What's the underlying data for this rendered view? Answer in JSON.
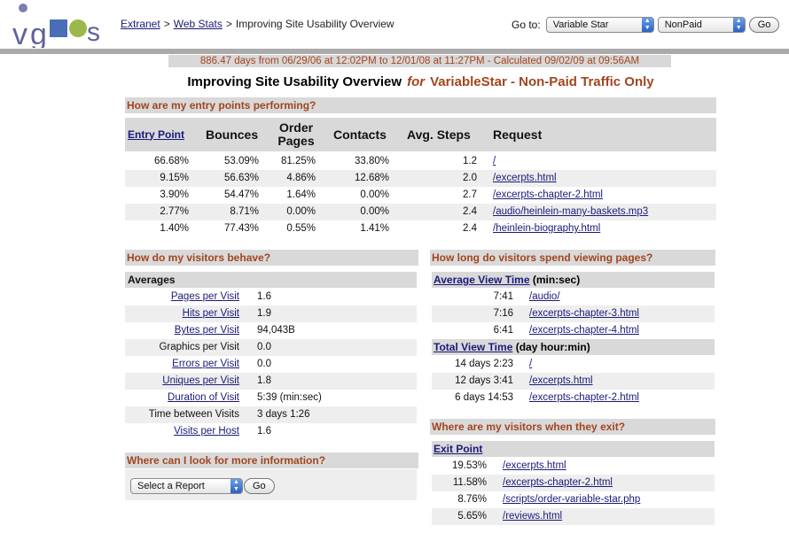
{
  "header": {
    "breadcrumb": {
      "extranet": "Extranet",
      "sep1": ">",
      "webstats": "Web Stats",
      "sep2": ">",
      "current": "Improving Site Usability Overview"
    },
    "goto_label": "Go to:",
    "site_select": "Variable Star",
    "traffic_select": "NonPaid",
    "go_button": "Go"
  },
  "date_range": "886.47 days from 06/29/06 at 12:02PM to 12/01/08 at 11:27PM - Calculated 09/02/09 at 09:56AM",
  "title": {
    "main": "Improving Site Usability Overview",
    "for": "for",
    "target": "VariableStar - Non-Paid Traffic Only"
  },
  "entry": {
    "heading": "How are my entry points performing?",
    "columns": {
      "entry_point": "Entry Point",
      "bounces": "Bounces",
      "order_pages_1": "Order",
      "order_pages_2": "Pages",
      "contacts": "Contacts",
      "avg_steps": "Avg. Steps",
      "request": "Request"
    },
    "rows": [
      {
        "entry": "66.68%",
        "bounces": "53.09%",
        "order": "81.25%",
        "contacts": "33.80%",
        "steps": "1.2",
        "request": "/"
      },
      {
        "entry": "9.15%",
        "bounces": "56.63%",
        "order": "4.86%",
        "contacts": "12.68%",
        "steps": "2.0",
        "request": "/excerpts.html"
      },
      {
        "entry": "3.90%",
        "bounces": "54.47%",
        "order": "1.64%",
        "contacts": "0.00%",
        "steps": "2.7",
        "request": "/excerpts-chapter-2.html"
      },
      {
        "entry": "2.77%",
        "bounces": "8.71%",
        "order": "0.00%",
        "contacts": "0.00%",
        "steps": "2.4",
        "request": "/audio/heinlein-many-baskets.mp3"
      },
      {
        "entry": "1.40%",
        "bounces": "77.43%",
        "order": "0.55%",
        "contacts": "1.41%",
        "steps": "2.4",
        "request": "/heinlein-biography.html"
      }
    ]
  },
  "behave": {
    "heading": "How do my visitors behave?",
    "sub": "Averages",
    "rows": [
      {
        "label": "Pages per Visit",
        "value": "1.6"
      },
      {
        "label": "Hits per Visit",
        "value": "1.9"
      },
      {
        "label": "Bytes per Visit",
        "value": "94,043B"
      },
      {
        "label": "Graphics per Visit",
        "value": "0.0"
      },
      {
        "label": "Errors per Visit",
        "value": "0.0"
      },
      {
        "label": "Uniques per Visit",
        "value": "1.8"
      },
      {
        "label": "Duration of Visit",
        "value": "5:39 (min:sec)"
      },
      {
        "label": "Time between Visits",
        "value": "3 days 1:26"
      },
      {
        "label": "Visits per Host",
        "value": "1.6"
      }
    ]
  },
  "more": {
    "heading": "Where can I look for more information?",
    "select": "Select a Report",
    "go_button": "Go"
  },
  "viewing": {
    "heading": "How long do visitors spend viewing pages?",
    "avg_label": "Average View Time",
    "avg_unit": "(min:sec)",
    "avg_rows": [
      {
        "time": "7:41",
        "page": "/audio/"
      },
      {
        "time": "7:16",
        "page": "/excerpts-chapter-3.html"
      },
      {
        "time": "6:41",
        "page": "/excerpts-chapter-4.html"
      }
    ],
    "total_label": "Total View Time",
    "total_unit": "(day hour:min)",
    "total_rows": [
      {
        "time": "14 days 2:23",
        "page": "/"
      },
      {
        "time": "12 days 3:41",
        "page": "/excerpts.html"
      },
      {
        "time": "6 days 14:53",
        "page": "/excerpts-chapter-2.html"
      }
    ]
  },
  "exit": {
    "heading": "Where are my visitors when they exit?",
    "sub": "Exit Point",
    "rows": [
      {
        "pct": "19.53%",
        "page": "/excerpts.html"
      },
      {
        "pct": "11.58%",
        "page": "/excerpts-chapter-2.html"
      },
      {
        "pct": "8.76%",
        "page": "/scripts/order-variable-star.php"
      },
      {
        "pct": "5.65%",
        "page": "/reviews.html"
      }
    ]
  },
  "colors": {
    "accent": "#a2451f",
    "link": "#1a1a7a",
    "section_bg": "#d9d9d9",
    "row_alt": "#eeeeee"
  }
}
